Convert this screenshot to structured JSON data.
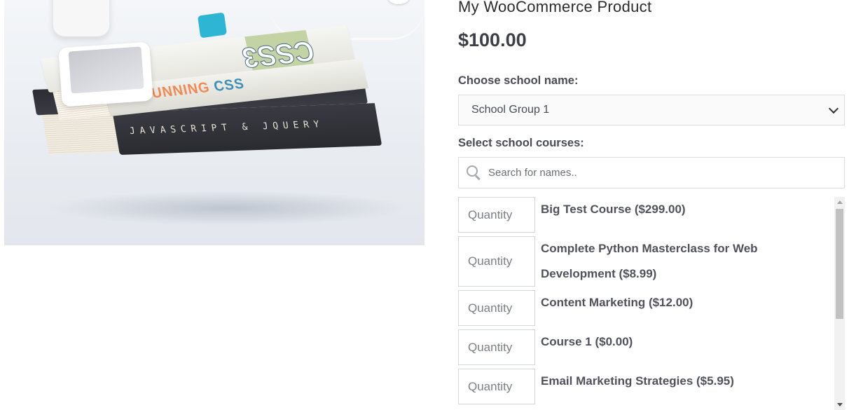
{
  "product": {
    "title": "My WooCommerce Product",
    "price": "$100.00",
    "image": {
      "book_top_title_a": "STUNNING ",
      "book_top_title_b": "CSS",
      "book_top_big": "CSS3",
      "book_bottom_spine": "JAVASCRIPT & JQUERY"
    }
  },
  "school": {
    "label": "Choose school name:",
    "selected": "School Group 1"
  },
  "courses": {
    "label": "Select school courses:",
    "search_placeholder": "Search for names..",
    "quantity_placeholder": "Quantity",
    "items": [
      {
        "name": "Big Test Course ($299.00)"
      },
      {
        "name": "Complete Python Masterclass for Web Development ($8.99)"
      },
      {
        "name": "Content Marketing ($12.00)"
      },
      {
        "name": "Course 1 ($0.00)"
      },
      {
        "name": "Email Marketing Strategies ($5.95)"
      }
    ]
  },
  "icons": {
    "search": "search-icon",
    "select_arrow": "chevron-down-icon"
  }
}
